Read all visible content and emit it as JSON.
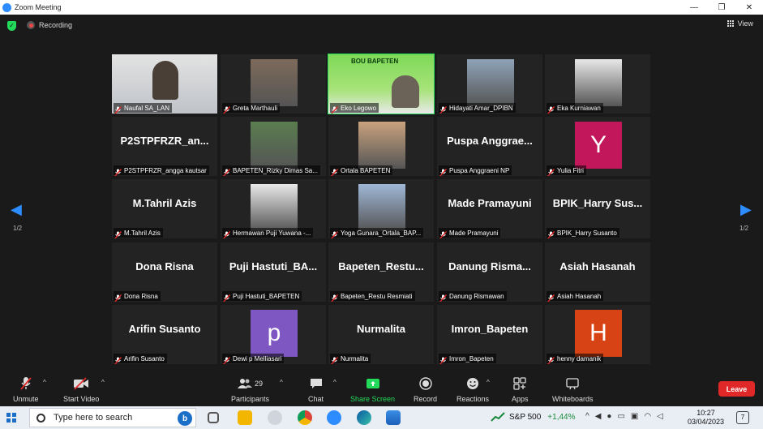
{
  "window": {
    "title": "Zoom Meeting",
    "min_glyph": "—",
    "max_glyph": "❐",
    "close_glyph": "✕"
  },
  "topbar": {
    "recording_label": "Recording",
    "view_label": "View"
  },
  "pager": {
    "left_page": "1/2",
    "right_page": "1/2"
  },
  "colors": {
    "accent": "#2d8cff",
    "active": "#23d959",
    "leave": "#e02828",
    "muted_mic": "#e02828"
  },
  "tiles": [
    {
      "kind": "video",
      "name": "Naufal SA_LAN"
    },
    {
      "kind": "photo",
      "name": "Greta Marthauli"
    },
    {
      "kind": "video",
      "name": "Eko Legowo",
      "banner": "BOU BAPETEN",
      "active": true
    },
    {
      "kind": "photo",
      "name": "Hidayati Amar_DPIBN"
    },
    {
      "kind": "photo",
      "name": "Eka Kurniawan"
    },
    {
      "kind": "text",
      "big": "P2STPFRZR_an...",
      "name": "P2STPFRZR_angga kautsar"
    },
    {
      "kind": "photo",
      "name": "BAPETEN_Rizky Dimas Sa..."
    },
    {
      "kind": "photo",
      "name": "Ortala BAPETEN"
    },
    {
      "kind": "text",
      "big": "Puspa Anggrae...",
      "name": "Puspa Anggraeni NP"
    },
    {
      "kind": "letter",
      "letter": "Y",
      "color": "#c2185b",
      "name": "Yulia Fitri"
    },
    {
      "kind": "text",
      "big": "M.Tahril Azis",
      "name": "M.Tahril Azis"
    },
    {
      "kind": "photo",
      "name": "Hermawan Puji Yuwana -..."
    },
    {
      "kind": "photo",
      "name": "Yoga Gunara_Ortala_BAP..."
    },
    {
      "kind": "text",
      "big": "Made Pramayuni",
      "name": "Made Pramayuni"
    },
    {
      "kind": "text",
      "big": "BPIK_Harry Sus...",
      "name": "BPIK_Harry Susanto"
    },
    {
      "kind": "text",
      "big": "Dona Risna",
      "name": "Dona Risna"
    },
    {
      "kind": "text",
      "big": "Puji Hastuti_BA...",
      "name": "Puji Hastuti_BAPETEN"
    },
    {
      "kind": "text",
      "big": "Bapeten_Restu...",
      "name": "Bapeten_Restu Resmiati"
    },
    {
      "kind": "text",
      "big": "Danung Risma...",
      "name": "Danung Rismawan"
    },
    {
      "kind": "text",
      "big": "Asiah Hasanah",
      "name": "Asiah Hasanah"
    },
    {
      "kind": "text",
      "big": "Arifin Susanto",
      "name": "Arifin Susanto"
    },
    {
      "kind": "letter",
      "letter": "p",
      "color": "#7e57c2",
      "name": "Dewi p Melliasari"
    },
    {
      "kind": "text",
      "big": "Nurmalita",
      "name": "Nurmalita"
    },
    {
      "kind": "text",
      "big": "Imron_Bapeten",
      "name": "Imron_Bapeten"
    },
    {
      "kind": "letter",
      "letter": "H",
      "color": "#d84315",
      "name": "henny damanik"
    }
  ],
  "toolbar": {
    "unmute": "Unmute",
    "start_video": "Start Video",
    "participants": "Participants",
    "participants_count": "29",
    "chat": "Chat",
    "share_screen": "Share Screen",
    "record": "Record",
    "reactions": "Reactions",
    "apps": "Apps",
    "whiteboards": "Whiteboards",
    "leave": "Leave"
  },
  "taskbar": {
    "search_placeholder": "Type here to search",
    "stock_name": "S&P 500",
    "stock_change": "+1,44%",
    "time": "10:27",
    "date": "03/04/2023",
    "notifications": "7"
  }
}
